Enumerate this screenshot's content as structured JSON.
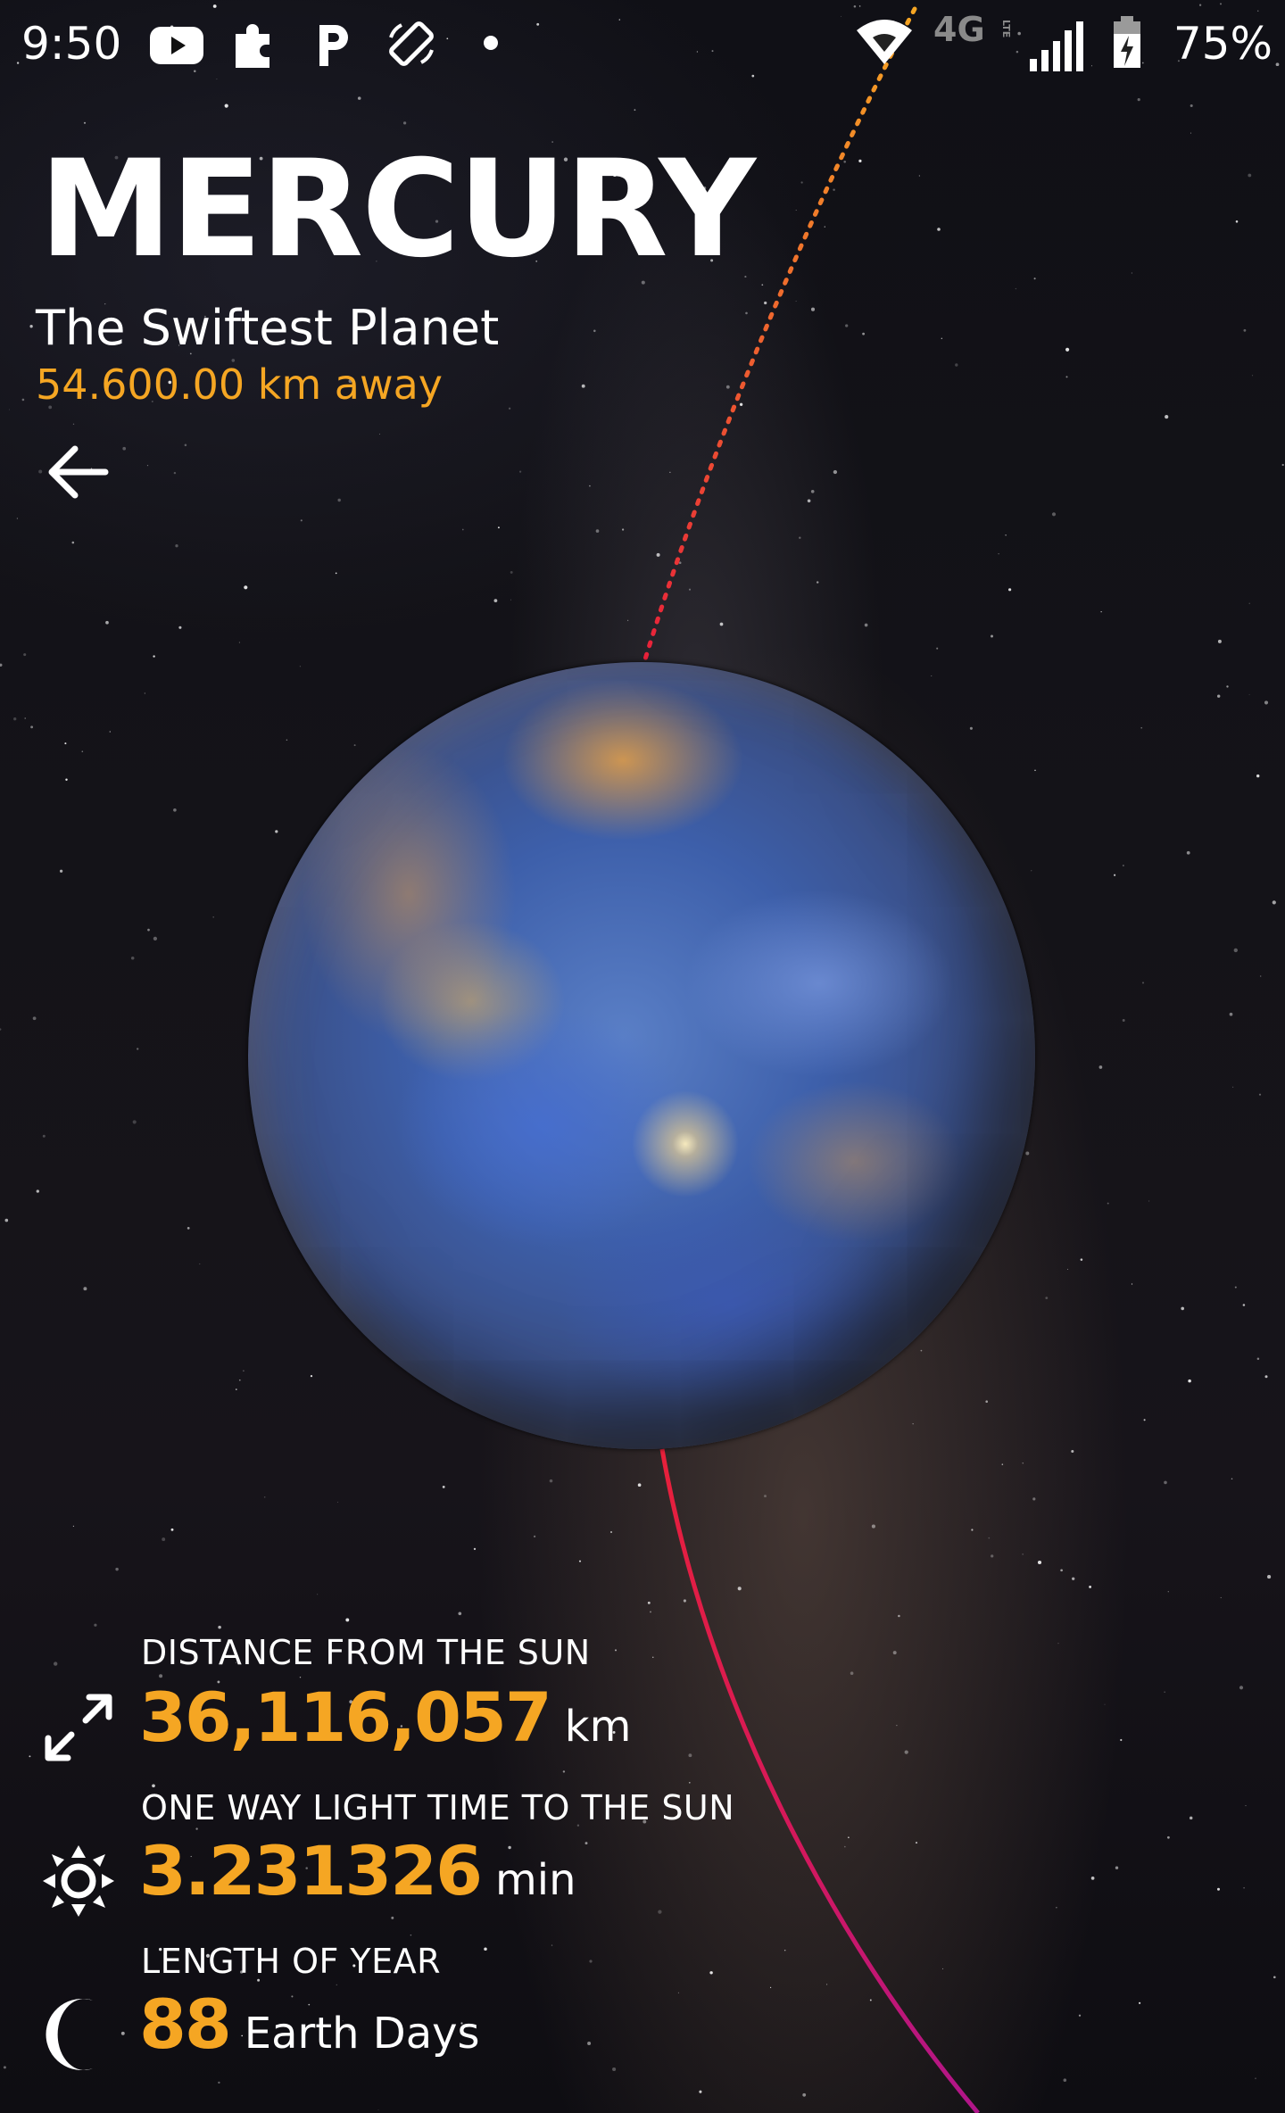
{
  "status_bar": {
    "time": "9:50",
    "network": "4G",
    "battery": "75%",
    "icons": [
      "youtube-icon",
      "puzzle-icon",
      "parking-icon",
      "rotate-icon",
      "dot-icon",
      "wifi-icon",
      "4g-lte-icon",
      "signal-icon",
      "battery-charging-icon"
    ]
  },
  "header": {
    "title": "MERCURY",
    "subtitle": "The Swiftest Planet",
    "distance_away": "54.600.00 km away"
  },
  "stats": [
    {
      "label": "DISTANCE FROM THE SUN",
      "value": "36,116,057",
      "unit": "km",
      "icon": "expand-arrows-icon"
    },
    {
      "label": "ONE WAY LIGHT TIME TO THE SUN",
      "value": "3.231326",
      "unit": "min",
      "icon": "sun-icon"
    },
    {
      "label": "LENGTH OF YEAR",
      "value": "88",
      "unit": "Earth Days",
      "icon": "moon-icon"
    }
  ],
  "colors": {
    "accent": "#f5a623",
    "text": "#ffffff",
    "orbit_start": "#f5a623",
    "orbit_mid": "#e8203a",
    "orbit_end": "#b0158a"
  }
}
